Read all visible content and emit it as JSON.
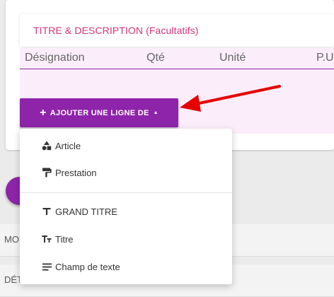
{
  "section": {
    "title_label": "TITRE & DESCRIPTION (Facultatifs)"
  },
  "table": {
    "columns": [
      "Désignation",
      "Qté",
      "Unité",
      "P.U"
    ]
  },
  "add_button": {
    "label": "AJOUTER UNE LIGNE DE",
    "plus": "+",
    "caret": "▲"
  },
  "background_rows": [
    {
      "label": "MO"
    },
    {
      "label": "DÉT"
    }
  ],
  "dropdown": {
    "items": [
      {
        "label": "Article",
        "icon": "shapes-icon"
      },
      {
        "label": "Prestation",
        "icon": "paint-roller-icon"
      },
      {
        "label": "GRAND TITRE",
        "icon": "format-title-icon"
      },
      {
        "label": "Titre",
        "icon": "format-size-icon"
      },
      {
        "label": "Champ de texte",
        "icon": "text-lines-icon"
      }
    ]
  },
  "colors": {
    "accent": "#8e24aa",
    "title_pink": "#d6337a",
    "annotation_arrow": "#e60000"
  }
}
